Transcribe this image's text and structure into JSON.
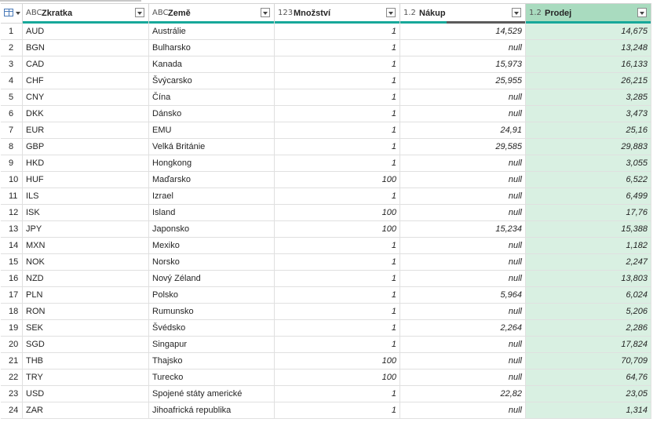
{
  "columns": [
    {
      "type_icon": "ABC",
      "name": "Zkratka"
    },
    {
      "type_icon": "ABC",
      "name": "Země"
    },
    {
      "type_icon": "123",
      "name": "Množství"
    },
    {
      "type_icon": "1.2",
      "name": "Nákup"
    },
    {
      "type_icon": "1.2",
      "name": "Prodej"
    }
  ],
  "rows": [
    {
      "i": "1",
      "code": "AUD",
      "country": "Austrálie",
      "qty": "1",
      "buy": "14,529",
      "sell": "14,675"
    },
    {
      "i": "2",
      "code": "BGN",
      "country": "Bulharsko",
      "qty": "1",
      "buy": "null",
      "sell": "13,248"
    },
    {
      "i": "3",
      "code": "CAD",
      "country": "Kanada",
      "qty": "1",
      "buy": "15,973",
      "sell": "16,133"
    },
    {
      "i": "4",
      "code": "CHF",
      "country": "Švýcarsko",
      "qty": "1",
      "buy": "25,955",
      "sell": "26,215"
    },
    {
      "i": "5",
      "code": "CNY",
      "country": "Čína",
      "qty": "1",
      "buy": "null",
      "sell": "3,285"
    },
    {
      "i": "6",
      "code": "DKK",
      "country": "Dánsko",
      "qty": "1",
      "buy": "null",
      "sell": "3,473"
    },
    {
      "i": "7",
      "code": "EUR",
      "country": "EMU",
      "qty": "1",
      "buy": "24,91",
      "sell": "25,16"
    },
    {
      "i": "8",
      "code": "GBP",
      "country": "Velká Británie",
      "qty": "1",
      "buy": "29,585",
      "sell": "29,883"
    },
    {
      "i": "9",
      "code": "HKD",
      "country": "Hongkong",
      "qty": "1",
      "buy": "null",
      "sell": "3,055"
    },
    {
      "i": "10",
      "code": "HUF",
      "country": "Maďarsko",
      "qty": "100",
      "buy": "null",
      "sell": "6,522"
    },
    {
      "i": "11",
      "code": "ILS",
      "country": "Izrael",
      "qty": "1",
      "buy": "null",
      "sell": "6,499"
    },
    {
      "i": "12",
      "code": "ISK",
      "country": "Island",
      "qty": "100",
      "buy": "null",
      "sell": "17,76"
    },
    {
      "i": "13",
      "code": "JPY",
      "country": "Japonsko",
      "qty": "100",
      "buy": "15,234",
      "sell": "15,388"
    },
    {
      "i": "14",
      "code": "MXN",
      "country": "Mexiko",
      "qty": "1",
      "buy": "null",
      "sell": "1,182"
    },
    {
      "i": "15",
      "code": "NOK",
      "country": "Norsko",
      "qty": "1",
      "buy": "null",
      "sell": "2,247"
    },
    {
      "i": "16",
      "code": "NZD",
      "country": "Nový Zéland",
      "qty": "1",
      "buy": "null",
      "sell": "13,803"
    },
    {
      "i": "17",
      "code": "PLN",
      "country": "Polsko",
      "qty": "1",
      "buy": "5,964",
      "sell": "6,024"
    },
    {
      "i": "18",
      "code": "RON",
      "country": "Rumunsko",
      "qty": "1",
      "buy": "null",
      "sell": "5,206"
    },
    {
      "i": "19",
      "code": "SEK",
      "country": "Švédsko",
      "qty": "1",
      "buy": "2,264",
      "sell": "2,286"
    },
    {
      "i": "20",
      "code": "SGD",
      "country": "Singapur",
      "qty": "1",
      "buy": "null",
      "sell": "17,824"
    },
    {
      "i": "21",
      "code": "THB",
      "country": "Thajsko",
      "qty": "100",
      "buy": "null",
      "sell": "70,709"
    },
    {
      "i": "22",
      "code": "TRY",
      "country": "Turecko",
      "qty": "100",
      "buy": "null",
      "sell": "64,76"
    },
    {
      "i": "23",
      "code": "USD",
      "country": "Spojené státy americké",
      "qty": "1",
      "buy": "22,82",
      "sell": "23,05"
    },
    {
      "i": "24",
      "code": "ZAR",
      "country": "Jihoafrická republika",
      "qty": "1",
      "buy": "null",
      "sell": "1,314"
    }
  ],
  "colors": {
    "quality_bar": "#17a89a",
    "selected_header": "#a9dbbf",
    "selected_cells": "#d9f0e2"
  }
}
